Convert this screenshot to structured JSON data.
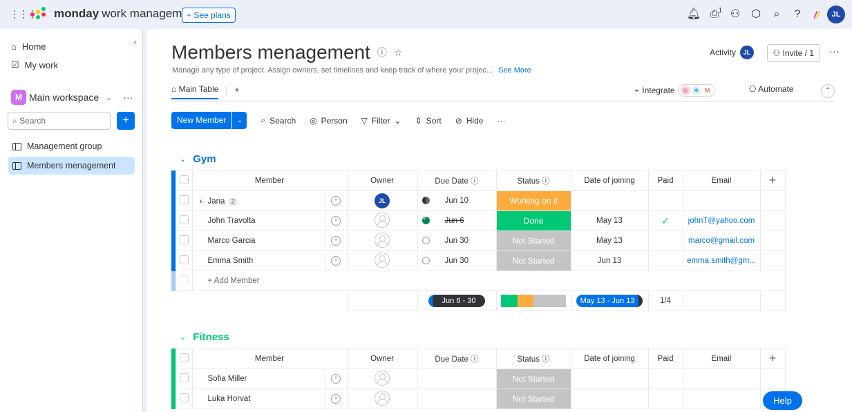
{
  "topbar": {
    "brand_bold": "monday",
    "brand_light": "work management",
    "see_plans": "+ See plans",
    "notification_count": "1",
    "user_initials": "JL"
  },
  "sidebar": {
    "home": "Home",
    "my_work": "My work",
    "workspace_initial": "M",
    "workspace_name": "Main workspace",
    "search_placeholder": "Search",
    "items": [
      {
        "label": "Management group",
        "active": false
      },
      {
        "label": "Members menagement",
        "active": true
      }
    ]
  },
  "board": {
    "title": "Members menagement",
    "description": "Manage any type of project. Assign owners, set timelines and keep track of where your projec...",
    "see_more": "See More",
    "activity": "Activity",
    "activity_initials": "JL",
    "invite": "Invite / 1",
    "tab_main": "Main Table",
    "integrate": "Integrate",
    "automate": "Automate"
  },
  "toolbar": {
    "new_item": "New Member",
    "search": "Search",
    "person": "Person",
    "filter": "Filter",
    "sort": "Sort",
    "hide": "Hide"
  },
  "columns": {
    "member": "Member",
    "owner": "Owner",
    "due_date": "Due Date",
    "status": "Status",
    "date_of_joining": "Date of joining",
    "paid": "Paid",
    "email": "Email"
  },
  "groups": [
    {
      "name": "Gym",
      "color": "#0073ea",
      "add_item": "+ Add Member",
      "rows": [
        {
          "name": "Jana",
          "subitems": "2",
          "owner": "JL",
          "due": "Jun 10",
          "due_state": "half",
          "status": "Working on it",
          "status_color": "#fdab3d",
          "joined": "",
          "paid": "",
          "email": ""
        },
        {
          "name": "John Travolta",
          "owner": "",
          "due": "Jun 6",
          "due_state": "done",
          "status": "Done",
          "status_color": "#00c875",
          "joined": "May 13",
          "paid": "✓",
          "email": "johnT@yahoo.com"
        },
        {
          "name": "Marco Garcia",
          "owner": "",
          "due": "Jun 30",
          "due_state": "empty",
          "status": "Not Started",
          "status_color": "#c4c4c4",
          "joined": "May 13",
          "paid": "",
          "email": "marco@gmail.com"
        },
        {
          "name": "Emma Smith",
          "owner": "",
          "due": "Jun 30",
          "due_state": "empty",
          "status": "Not Started",
          "status_color": "#c4c4c4",
          "joined": "Jun 13",
          "paid": "",
          "email": "emma.smith@gm..."
        }
      ],
      "summary": {
        "due_range": "Jun 6 - 30",
        "joined_range": "May 13 - Jun 13",
        "paid_ratio": "1/4",
        "status_share": {
          "done": 0.25,
          "working": 0.25,
          "not_started": 0.5
        }
      }
    },
    {
      "name": "Fitness",
      "color": "#00c875",
      "rows": [
        {
          "name": "Sofia Miller",
          "status": "Not Started",
          "status_color": "#c4c4c4"
        },
        {
          "name": "Luka Horvat",
          "status": "Not Started",
          "status_color": "#c4c4c4"
        }
      ]
    }
  ],
  "help": "Help"
}
